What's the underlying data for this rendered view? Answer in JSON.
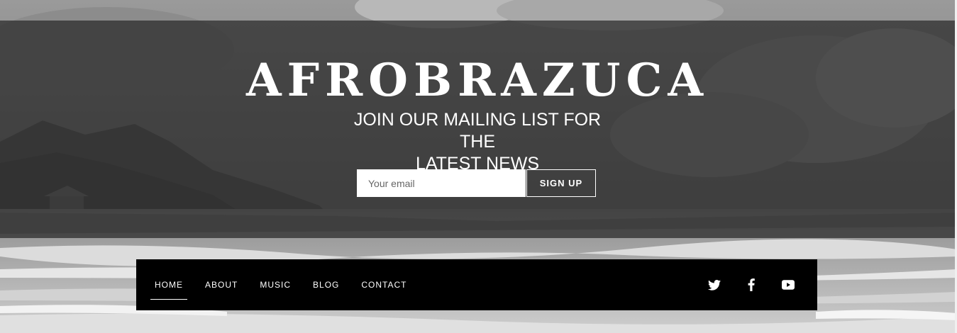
{
  "hero": {
    "brand": "AFROBRAZUCA",
    "tagline_line1": "JOIN OUR MAILING LIST FOR THE",
    "tagline_line2": "LATEST NEWS"
  },
  "signup": {
    "email_placeholder": "Your email",
    "email_value": "",
    "button_label": "SIGN UP"
  },
  "nav": {
    "items": [
      {
        "label": "HOME",
        "active": true
      },
      {
        "label": "ABOUT",
        "active": false
      },
      {
        "label": "MUSIC",
        "active": false
      },
      {
        "label": "BLOG",
        "active": false
      },
      {
        "label": "CONTACT",
        "active": false
      }
    ],
    "social": [
      "twitter-icon",
      "facebook-icon",
      "youtube-icon"
    ]
  },
  "colors": {
    "overlay": "#282828",
    "navbar": "#000000",
    "text": "#ffffff"
  }
}
